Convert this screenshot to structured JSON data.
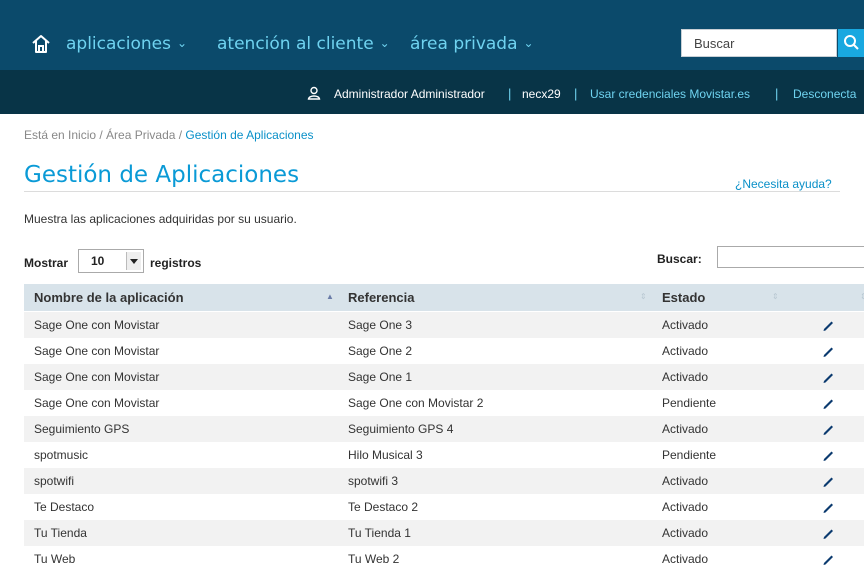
{
  "header": {
    "nav": [
      {
        "label": "aplicaciones"
      },
      {
        "label": "atención al cliente"
      },
      {
        "label": "área privada"
      }
    ],
    "search_placeholder": "Buscar"
  },
  "userbar": {
    "user": "Administrador Administrador",
    "login": "necx29",
    "credentials_link": "Usar credenciales Movistar.es",
    "logout": "Desconecta"
  },
  "breadcrumb": {
    "prefix": "Está en Inicio / Área Privada / ",
    "current": "Gestión de Aplicaciones"
  },
  "page": {
    "title": "Gestión de Aplicaciones",
    "help": "¿Necesita ayuda?",
    "description": "Muestra las aplicaciones adquiridas por su usuario."
  },
  "controls": {
    "show_label": "Mostrar",
    "page_size": "10",
    "records_label": "registros",
    "search_label": "Buscar:"
  },
  "table": {
    "columns": [
      "Nombre de la aplicación",
      "Referencia",
      "Estado"
    ],
    "rows": [
      {
        "name": "Sage One con Movistar",
        "ref": "Sage One 3",
        "status": "Activado"
      },
      {
        "name": "Sage One con Movistar",
        "ref": "Sage One 2",
        "status": "Activado"
      },
      {
        "name": "Sage One con Movistar",
        "ref": "Sage One 1",
        "status": "Activado"
      },
      {
        "name": "Sage One con Movistar",
        "ref": "Sage One con Movistar 2",
        "status": "Pendiente"
      },
      {
        "name": "Seguimiento GPS",
        "ref": "Seguimiento GPS 4",
        "status": "Activado"
      },
      {
        "name": "spotmusic",
        "ref": "Hilo Musical 3",
        "status": "Pendiente"
      },
      {
        "name": "spotwifi",
        "ref": "spotwifi 3",
        "status": "Activado"
      },
      {
        "name": "Te Destaco",
        "ref": "Te Destaco 2",
        "status": "Activado"
      },
      {
        "name": "Tu Tienda",
        "ref": "Tu Tienda 1",
        "status": "Activado"
      },
      {
        "name": "Tu Web",
        "ref": "Tu Web 2",
        "status": "Activado"
      }
    ]
  }
}
